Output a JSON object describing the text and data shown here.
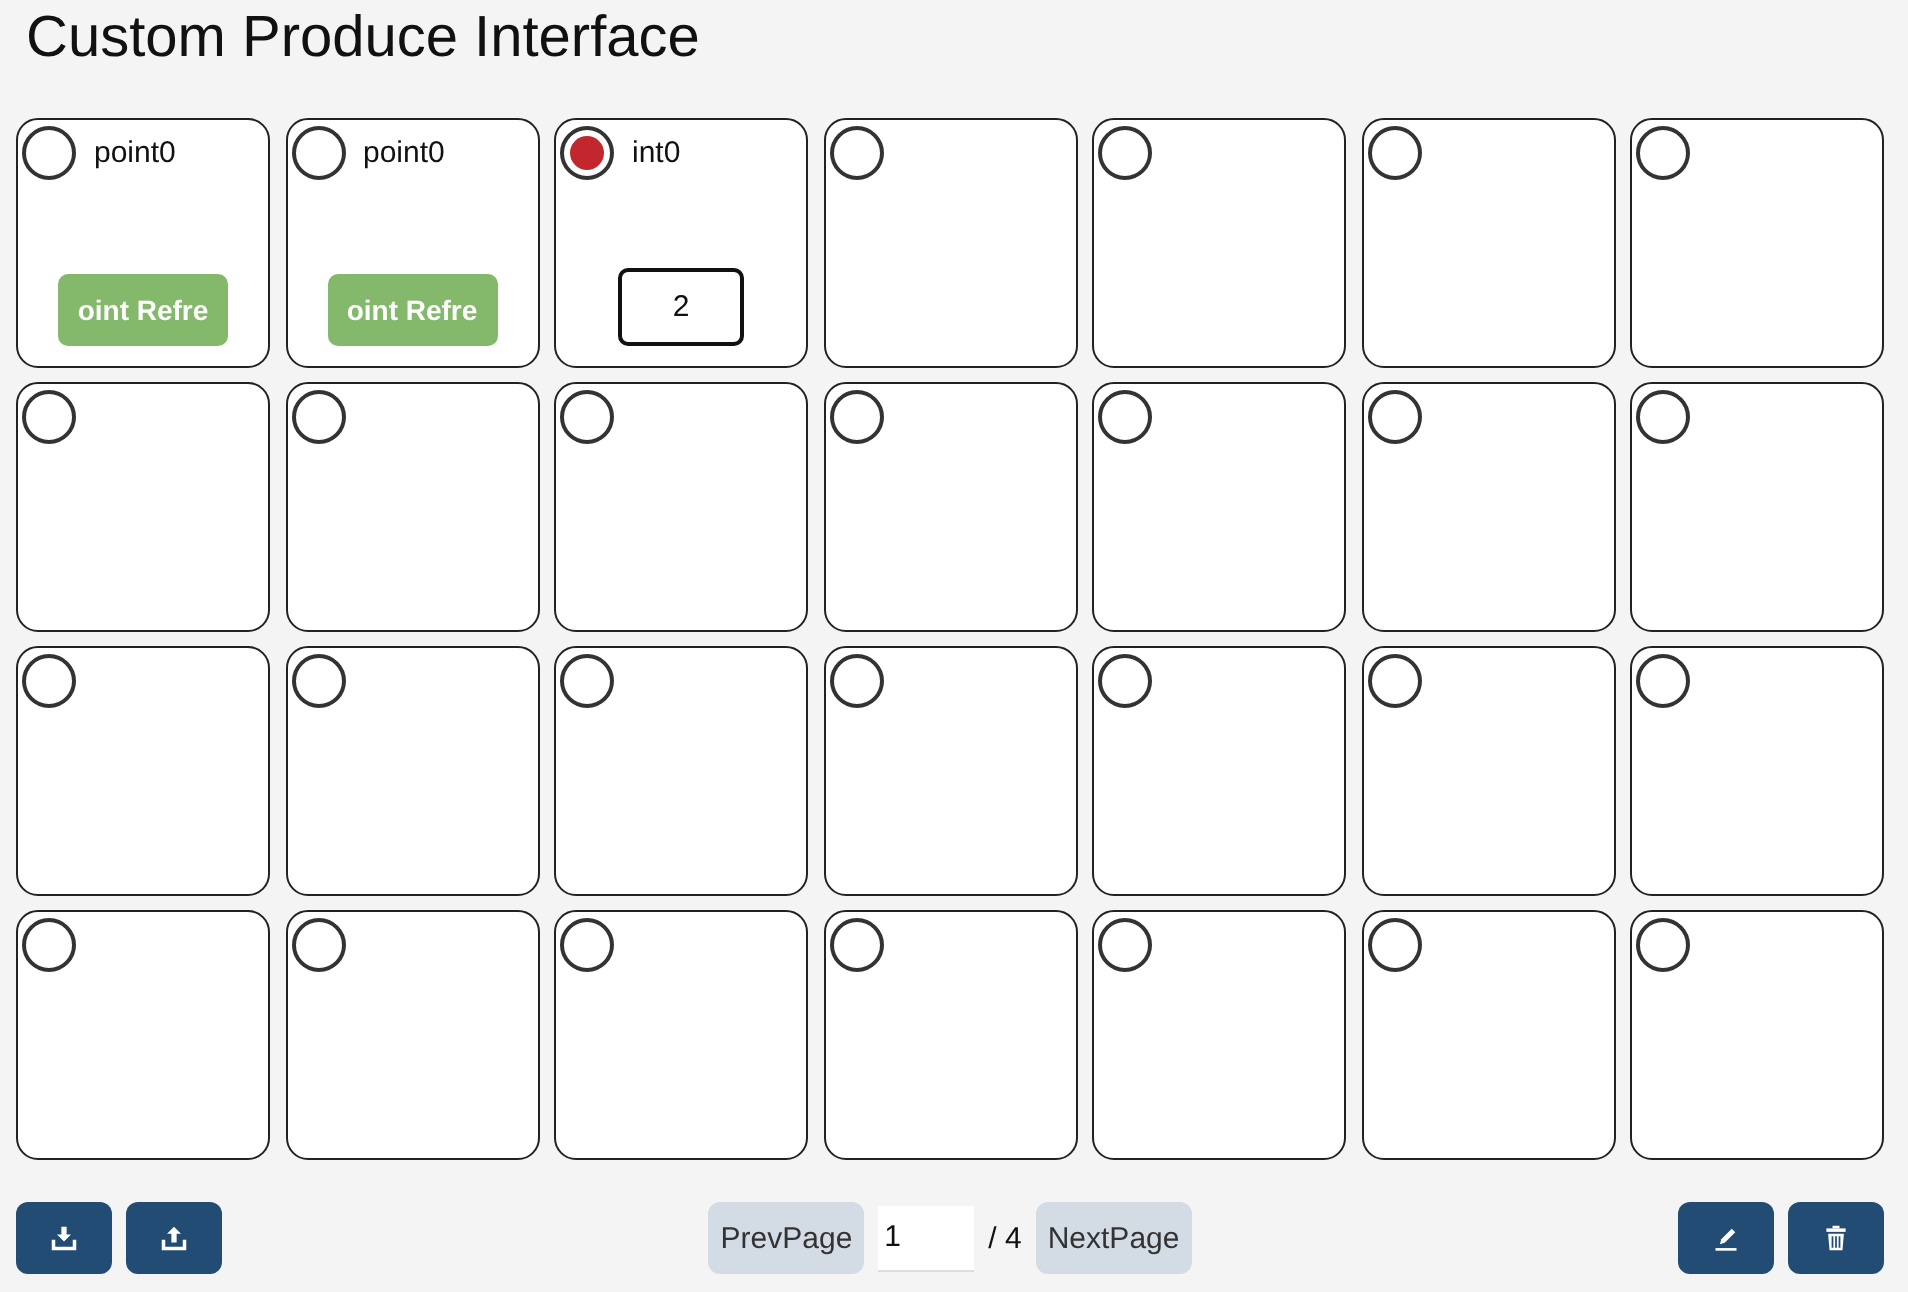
{
  "title": "Custom Produce Interface",
  "slots": [
    {
      "kind": "button",
      "selected": false,
      "label": "point0",
      "button": "oint Refre"
    },
    {
      "kind": "button",
      "selected": false,
      "label": "point0",
      "button": "oint Refre"
    },
    {
      "kind": "input",
      "selected": true,
      "label": "int0",
      "value": "2"
    },
    {
      "kind": "empty",
      "selected": false
    },
    {
      "kind": "empty",
      "selected": false
    },
    {
      "kind": "empty",
      "selected": false
    },
    {
      "kind": "empty",
      "selected": false
    },
    {
      "kind": "empty",
      "selected": false
    },
    {
      "kind": "empty",
      "selected": false
    },
    {
      "kind": "empty",
      "selected": false
    },
    {
      "kind": "empty",
      "selected": false
    },
    {
      "kind": "empty",
      "selected": false
    },
    {
      "kind": "empty",
      "selected": false
    },
    {
      "kind": "empty",
      "selected": false
    },
    {
      "kind": "empty",
      "selected": false
    },
    {
      "kind": "empty",
      "selected": false
    },
    {
      "kind": "empty",
      "selected": false
    },
    {
      "kind": "empty",
      "selected": false
    },
    {
      "kind": "empty",
      "selected": false
    },
    {
      "kind": "empty",
      "selected": false
    },
    {
      "kind": "empty",
      "selected": false
    },
    {
      "kind": "empty",
      "selected": false
    },
    {
      "kind": "empty",
      "selected": false
    },
    {
      "kind": "empty",
      "selected": false
    },
    {
      "kind": "empty",
      "selected": false
    },
    {
      "kind": "empty",
      "selected": false
    },
    {
      "kind": "empty",
      "selected": false
    },
    {
      "kind": "empty",
      "selected": false
    }
  ],
  "pagination": {
    "prev": "PrevPage",
    "page": "1",
    "total": "/ 4",
    "next": "NextPage"
  }
}
